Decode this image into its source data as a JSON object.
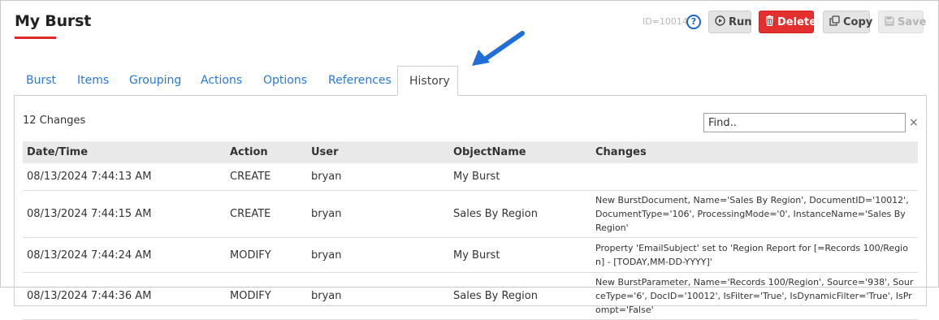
{
  "header": {
    "title": "My Burst",
    "doc_id": "ID=10014",
    "help_glyph": "?",
    "buttons": {
      "run": "Run",
      "delete": "Delete",
      "copy": "Copy",
      "save": "Save"
    }
  },
  "tabs": [
    {
      "label": "Burst"
    },
    {
      "label": "Items"
    },
    {
      "label": "Grouping"
    },
    {
      "label": "Actions"
    },
    {
      "label": "Options"
    },
    {
      "label": "References"
    },
    {
      "label": "History",
      "active": true
    }
  ],
  "history": {
    "count_label": "12 Changes",
    "find_placeholder": "Find..",
    "clear_glyph": "×",
    "columns": [
      "Date/Time",
      "Action",
      "User",
      "ObjectName",
      "Changes"
    ],
    "rows": [
      {
        "datetime": "08/13/2024 7:44:13 AM",
        "action": "CREATE",
        "user": "bryan",
        "object": "My Burst",
        "changes": ""
      },
      {
        "datetime": "08/13/2024 7:44:15 AM",
        "action": "CREATE",
        "user": "bryan",
        "object": "Sales By Region",
        "changes": "New BurstDocument, Name='Sales By Region', DocumentID='10012', DocumentType='106', ProcessingMode='0', InstanceName='Sales By Region'"
      },
      {
        "datetime": "08/13/2024 7:44:24 AM",
        "action": "MODIFY",
        "user": "bryan",
        "object": "My Burst",
        "changes": "Property 'EmailSubject' set to 'Region Report for [=Records 100/Region] - [TODAY,MM-DD-YYYY]'"
      },
      {
        "datetime": "08/13/2024 7:44:36 AM",
        "action": "MODIFY",
        "user": "bryan",
        "object": "Sales By Region",
        "changes": "New BurstParameter, Name='Records 100/Region', Source='938', SourceType='6', DocID='10012', IsFilter='True', IsDynamicFilter='True', IsPrompt='False'"
      }
    ]
  },
  "colors": {
    "accent_link": "#2a7ad8",
    "delete_red": "#e3302f",
    "title_underline": "#e02a2a",
    "annotation_arrow": "#1f6fd6"
  }
}
